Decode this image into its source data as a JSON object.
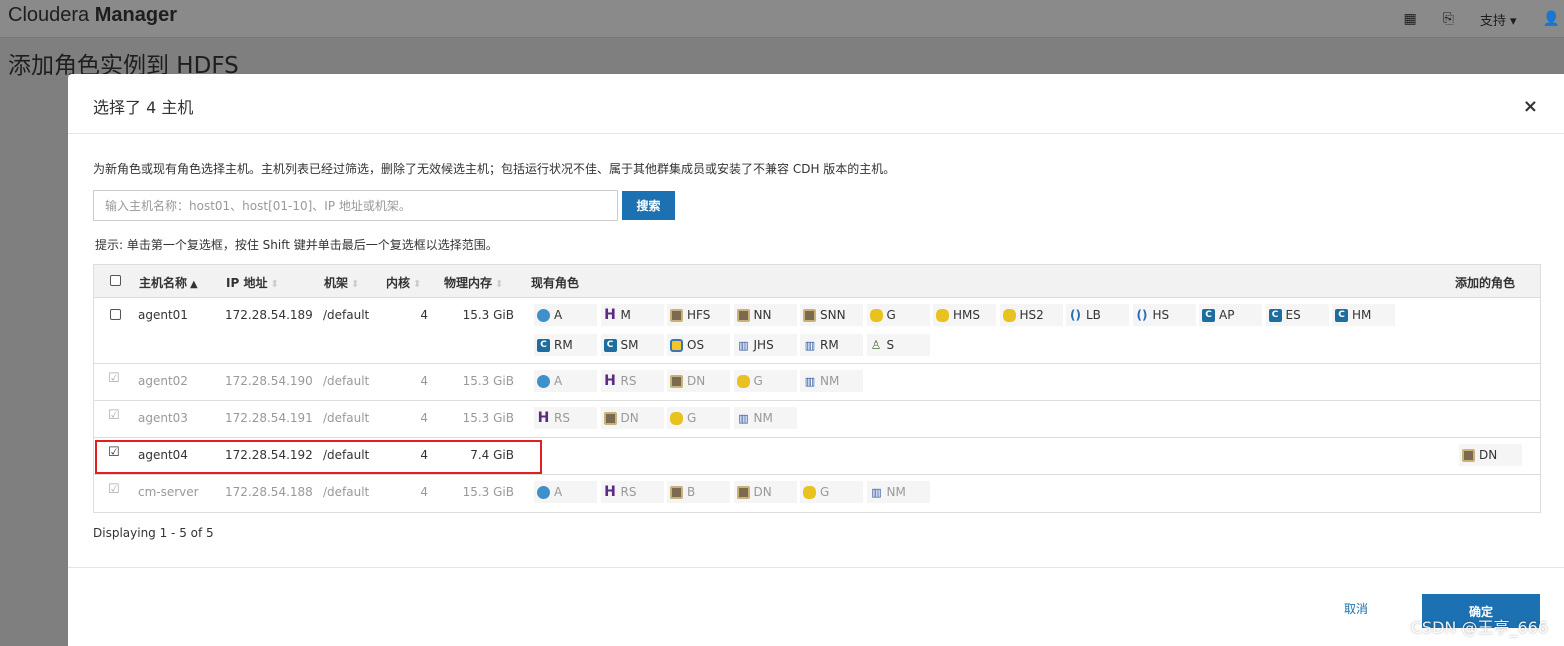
{
  "app": {
    "brand_light": "Cloudera",
    "brand_bold": "Manager",
    "support": "支持 ▾"
  },
  "page": {
    "title": "添加角色实例到 HDFS"
  },
  "modal": {
    "title": "选择了 4 主机",
    "close": "×",
    "description": "为新角色或现有角色选择主机。主机列表已经过筛选，删除了无效候选主机；包括运行状况不佳、属于其他群集成员或安装了不兼容 CDH 版本的主机。",
    "search_placeholder": "输入主机名称：host01、host[01-10]、IP 地址或机架。",
    "search_button": "搜索",
    "hint": "提示: 单击第一个复选框，按住 Shift 键并单击最后一个复选框以选择范围。",
    "columns": {
      "hostname": "主机名称",
      "ip": "IP 地址",
      "rack": "机架",
      "cores": "内核",
      "memory": "物理内存",
      "roles": "现有角色",
      "added": "添加的角色"
    },
    "rows": [
      {
        "host": "agent01",
        "ip": "172.28.54.189",
        "rack": "/default",
        "cores": "4",
        "mem": "15.3 GiB",
        "checked": false,
        "dim": false,
        "roles": [
          {
            "icon": "hue-icon",
            "label": "A"
          },
          {
            "icon": "hbase-icon",
            "label": "M"
          },
          {
            "icon": "hdfs-icon",
            "label": "HFS"
          },
          {
            "icon": "hdfs-icon",
            "label": "NN"
          },
          {
            "icon": "hdfs-icon",
            "label": "SNN"
          },
          {
            "icon": "hive-icon",
            "label": "G"
          },
          {
            "icon": "hive-icon",
            "label": "HMS"
          },
          {
            "icon": "hive-icon",
            "label": "HS2"
          },
          {
            "icon": "hue-lb-icon",
            "label": "LB"
          },
          {
            "icon": "hue-lb-icon",
            "label": "HS"
          },
          {
            "icon": "cm-icon",
            "label": "AP"
          },
          {
            "icon": "cm-icon",
            "label": "ES"
          },
          {
            "icon": "cm-icon",
            "label": "HM"
          },
          {
            "icon": "cm-icon",
            "label": "RM"
          },
          {
            "icon": "cm-icon",
            "label": "SM"
          },
          {
            "icon": "oozie-icon",
            "label": "OS"
          },
          {
            "icon": "yarn-icon",
            "label": "JHS"
          },
          {
            "icon": "yarn-icon",
            "label": "RM"
          },
          {
            "icon": "sqoop-icon",
            "label": "S"
          }
        ],
        "added": []
      },
      {
        "host": "agent02",
        "ip": "172.28.54.190",
        "rack": "/default",
        "cores": "4",
        "mem": "15.3 GiB",
        "checked": true,
        "dim": true,
        "roles": [
          {
            "icon": "hue-icon",
            "label": "A"
          },
          {
            "icon": "hbase-icon",
            "label": "RS"
          },
          {
            "icon": "hdfs-icon",
            "label": "DN"
          },
          {
            "icon": "hive-icon",
            "label": "G"
          },
          {
            "icon": "yarn-icon",
            "label": "NM"
          }
        ],
        "added": []
      },
      {
        "host": "agent03",
        "ip": "172.28.54.191",
        "rack": "/default",
        "cores": "4",
        "mem": "15.3 GiB",
        "checked": true,
        "dim": true,
        "roles": [
          {
            "icon": "hbase-icon",
            "label": "RS"
          },
          {
            "icon": "hdfs-icon",
            "label": "DN"
          },
          {
            "icon": "hive-icon",
            "label": "G"
          },
          {
            "icon": "yarn-icon",
            "label": "NM"
          }
        ],
        "added": []
      },
      {
        "host": "agent04",
        "ip": "172.28.54.192",
        "rack": "/default",
        "cores": "4",
        "mem": "7.4 GiB",
        "checked": true,
        "dim": false,
        "roles": [],
        "added": [
          {
            "icon": "hdfs-icon",
            "label": "DN"
          }
        ]
      },
      {
        "host": "cm-server",
        "ip": "172.28.54.188",
        "rack": "/default",
        "cores": "4",
        "mem": "15.3 GiB",
        "checked": true,
        "dim": true,
        "roles": [
          {
            "icon": "hue-icon",
            "label": "A"
          },
          {
            "icon": "hbase-icon",
            "label": "RS"
          },
          {
            "icon": "hdfs-icon",
            "label": "B"
          },
          {
            "icon": "hdfs-icon",
            "label": "DN"
          },
          {
            "icon": "hive-icon",
            "label": "G"
          },
          {
            "icon": "yarn-icon",
            "label": "NM"
          }
        ],
        "added": []
      }
    ],
    "displaying": "Displaying 1 - 5 of 5",
    "cancel": "取消",
    "ok": "确定"
  },
  "watermark": "CSDN @王亭_666"
}
